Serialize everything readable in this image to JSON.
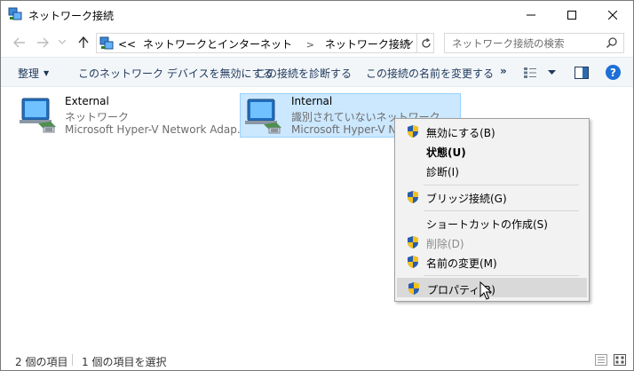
{
  "window": {
    "title": "ネットワーク接続"
  },
  "address": {
    "overflow": "<<",
    "crumbs": [
      "ネットワークとインターネット",
      "ネットワーク接続"
    ],
    "search_placeholder": "ネットワーク接続の検索"
  },
  "commandbar": {
    "organize": "整理",
    "disable": "このネットワーク デバイスを無効にする",
    "diagnose": "この接続を診断する",
    "rename": "この接続の名前を変更する",
    "more": "»",
    "help": "?"
  },
  "connections": [
    {
      "name": "External",
      "status": "ネットワーク",
      "device": "Microsoft Hyper-V Network Adap..."
    },
    {
      "name": "Internal",
      "status": "識別されていないネットワーク",
      "device": "Microsoft Hyper-V Network Adapter"
    }
  ],
  "context_menu": {
    "items": [
      {
        "label": "無効にする(B)",
        "shield": true
      },
      {
        "label": "状態(U)",
        "bold": true
      },
      {
        "label": "診断(I)"
      },
      {
        "label": "ブリッジ接続(G)",
        "shield": true
      },
      {
        "label": "ショートカットの作成(S)"
      },
      {
        "label": "削除(D)",
        "shield": true,
        "disabled": true
      },
      {
        "label": "名前の変更(M)",
        "shield": true
      },
      {
        "label": "プロパティ(R)",
        "shield": true,
        "hover": true
      }
    ]
  },
  "statusbar": {
    "count": "2 個の項目",
    "selected": "1 個の項目を選択"
  },
  "colors": {
    "selection_bg": "#cce8ff",
    "selection_border": "#99d1ff",
    "help_blue": "#1e6fd6",
    "menu_bg": "#f2f2f2"
  }
}
